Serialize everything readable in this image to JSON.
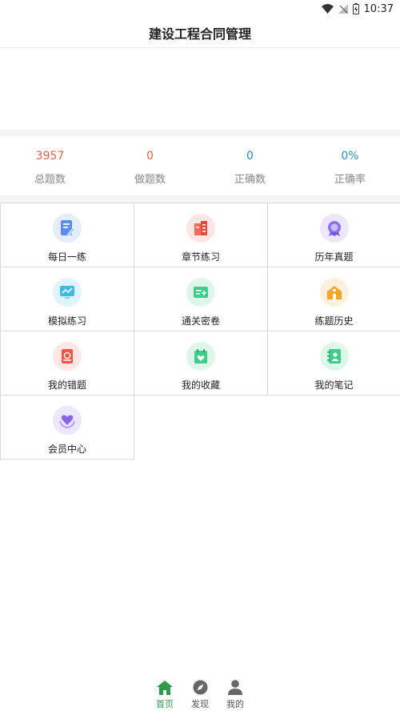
{
  "status_bar": {
    "time": "10:37"
  },
  "header": {
    "title": "建设工程合同管理"
  },
  "stats": [
    {
      "value": "3957",
      "label": "总题数",
      "color": "#e8654a"
    },
    {
      "value": "0",
      "label": "做题数",
      "color": "#e8654a"
    },
    {
      "value": "0",
      "label": "正确数",
      "color": "#2d8ccf"
    },
    {
      "value": "0%",
      "label": "正确率",
      "color": "#2d8ccf"
    }
  ],
  "menu": [
    {
      "label": "每日一练",
      "icon": "daily-practice-icon",
      "color": "#4f86e8"
    },
    {
      "label": "章节练习",
      "icon": "chapter-practice-icon",
      "color": "#ef5d4b"
    },
    {
      "label": "历年真题",
      "icon": "past-exam-icon",
      "color": "#7c65e6"
    },
    {
      "label": "模拟练习",
      "icon": "mock-practice-icon",
      "color": "#2fb7e8"
    },
    {
      "label": "通关密卷",
      "icon": "secret-paper-icon",
      "color": "#3ccf86"
    },
    {
      "label": "练题历史",
      "icon": "practice-history-icon",
      "color": "#f5a623"
    },
    {
      "label": "我的错题",
      "icon": "wrong-questions-icon",
      "color": "#ef5d4b"
    },
    {
      "label": "我的收藏",
      "icon": "favorites-icon",
      "color": "#3ccf86"
    },
    {
      "label": "我的笔记",
      "icon": "notes-icon",
      "color": "#3ccf86"
    },
    {
      "label": "会员中心",
      "icon": "member-center-icon",
      "color": "#8a63e8"
    }
  ],
  "tabbar": [
    {
      "label": "首页",
      "icon": "home-icon",
      "active": true
    },
    {
      "label": "发现",
      "icon": "compass-icon",
      "active": false
    },
    {
      "label": "我的",
      "icon": "user-icon",
      "active": false
    }
  ],
  "accent_color": "#2f9a4e"
}
